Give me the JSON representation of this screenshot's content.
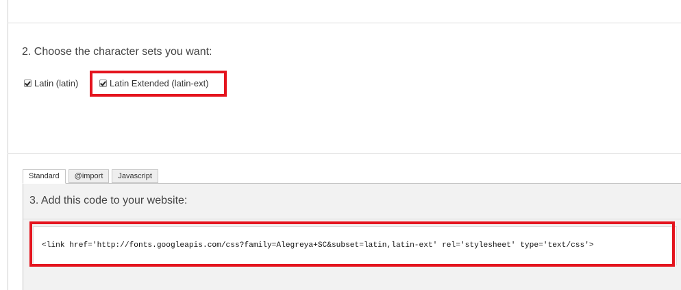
{
  "step2": {
    "title": "2. Choose the character sets you want:",
    "charsets": [
      {
        "label": "Latin (latin)",
        "checked": true
      },
      {
        "label": "Latin Extended (latin-ext)",
        "checked": true,
        "highlighted": true
      }
    ]
  },
  "step3": {
    "tabs": [
      {
        "label": "Standard",
        "active": true
      },
      {
        "label": "@import",
        "active": false
      },
      {
        "label": "Javascript",
        "active": false
      }
    ],
    "title": "3. Add this code to your website:",
    "code": "<link href='http://fonts.googleapis.com/css?family=Alegreya+SC&subset=latin,latin-ext' rel='stylesheet' type='text/css'>",
    "code_highlighted": true
  },
  "colors": {
    "highlight": "#e4141e",
    "panel_bg": "#f2f2f2",
    "divider": "#dddddd"
  }
}
